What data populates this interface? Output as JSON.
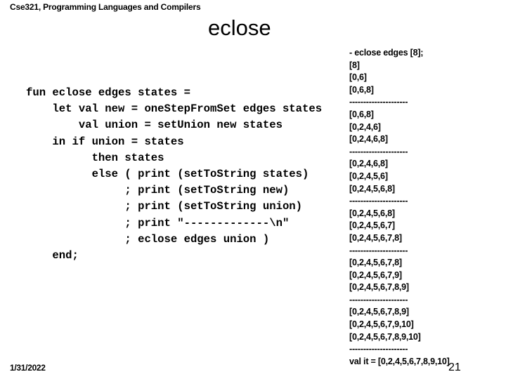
{
  "header": {
    "course_title": "Cse321, Programming Languages and Compilers"
  },
  "slide": {
    "title": "eclose"
  },
  "code": {
    "lines": [
      "fun eclose edges states =",
      "    let val new = oneStepFromSet edges states",
      "        val union = setUnion new states",
      "    in if union = states",
      "          then states",
      "          else ( print (setToString states)",
      "               ; print (setToString new)",
      "               ; print (setToString union)",
      "               ; print \"-------------\\n\"",
      "               ; eclose edges union )",
      "    end;"
    ]
  },
  "output": {
    "lines": [
      "- eclose edges [8];",
      "[8]",
      "[0,6]",
      "[0,6,8]",
      "---------------------",
      "[0,6,8]",
      "[0,2,4,6]",
      "[0,2,4,6,8]",
      "---------------------",
      "[0,2,4,6,8]",
      "[0,2,4,5,6]",
      "[0,2,4,5,6,8]",
      "---------------------",
      "[0,2,4,5,6,8]",
      "[0,2,4,5,6,7]",
      "[0,2,4,5,6,7,8]",
      "---------------------",
      "[0,2,4,5,6,7,8]",
      "[0,2,4,5,6,7,9]",
      "[0,2,4,5,6,7,8,9]",
      "---------------------",
      "[0,2,4,5,6,7,8,9]",
      "[0,2,4,5,6,7,9,10]",
      "[0,2,4,5,6,7,8,9,10]",
      "---------------------",
      "val it = [0,2,4,5,6,7,8,9,10]"
    ]
  },
  "footer": {
    "date": "1/31/2022",
    "page_number": "21"
  }
}
